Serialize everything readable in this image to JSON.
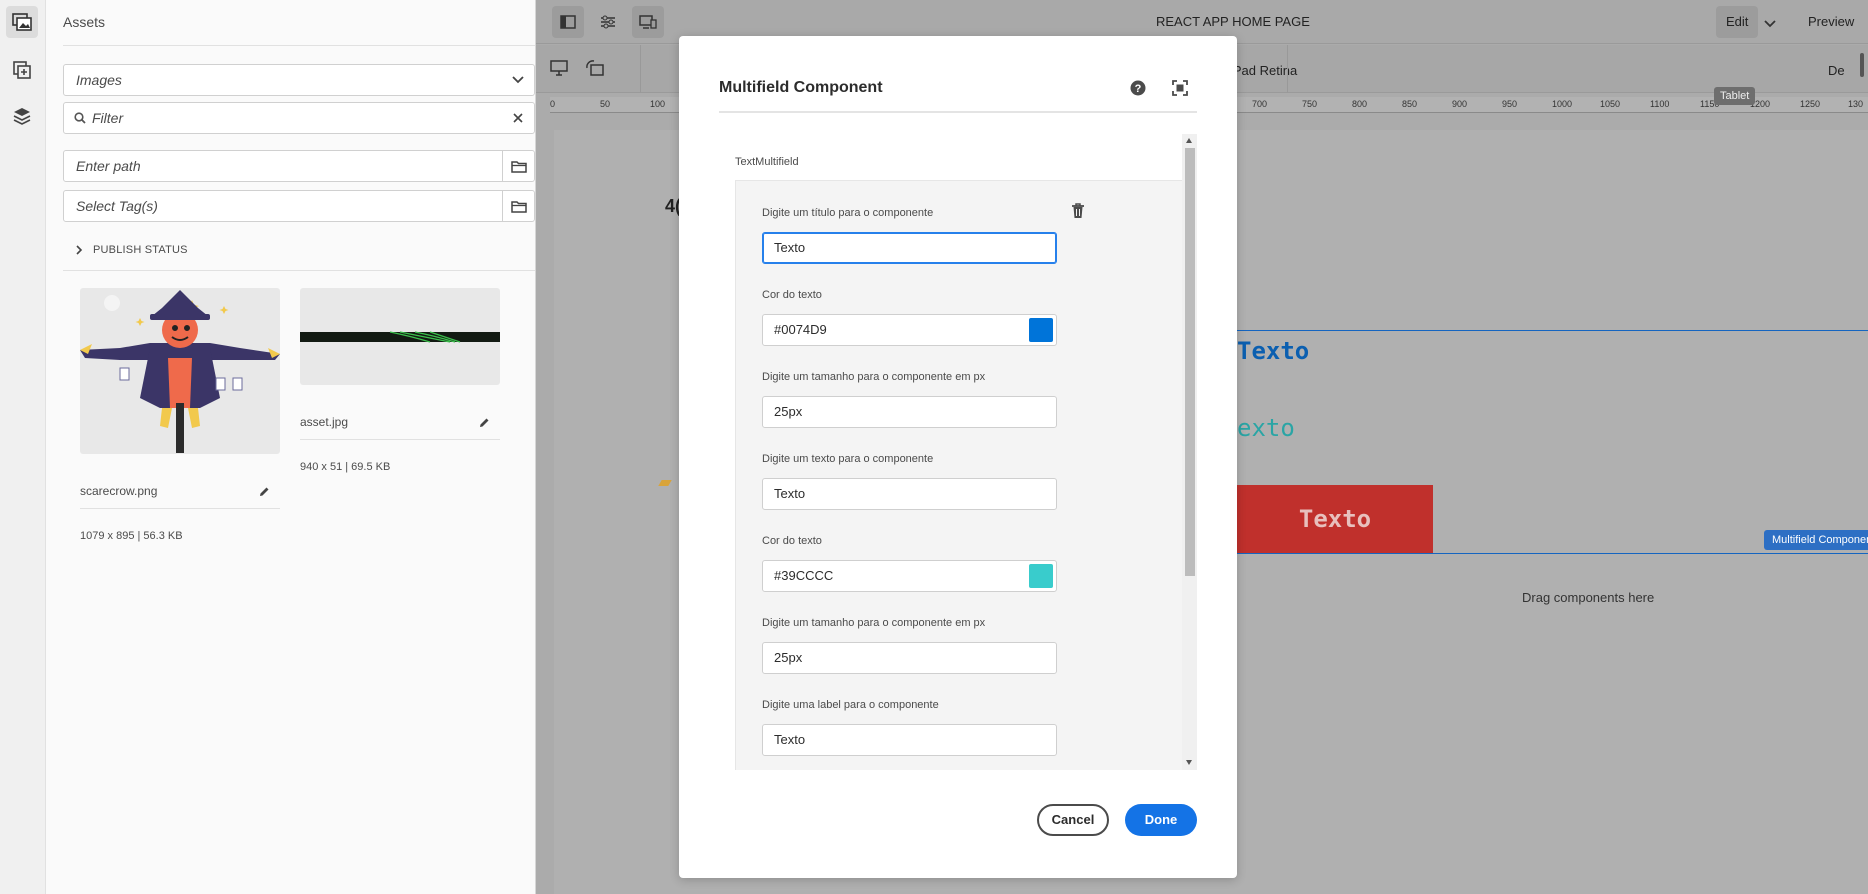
{
  "rail": {
    "icons": [
      "assets-icon",
      "components-icon",
      "layers-icon"
    ]
  },
  "assets_panel": {
    "title": "Assets",
    "type_select": "Images",
    "filter_placeholder": "Filter",
    "path_placeholder": "Enter path",
    "tags_placeholder": "Select Tag(s)",
    "publish_status": "PUBLISH STATUS",
    "cards": [
      {
        "name": "scarecrow.png",
        "meta": "1079 x 895 | 56.3 KB"
      },
      {
        "name": "asset.jpg",
        "meta": "940 x 51 | 69.5 KB"
      }
    ]
  },
  "editor": {
    "page_title": "REACT APP HOME PAGE",
    "mode": "Edit",
    "preview": "Preview",
    "device_label": "iPad Retina",
    "device_label_right": "De",
    "tooltip": "Tablet",
    "ruler": [
      "0",
      "50",
      "100",
      "700",
      "750",
      "800",
      "850",
      "900",
      "950",
      "1000",
      "1050",
      "1100",
      "1150",
      "1200",
      "1250",
      "130"
    ],
    "canvas_text_left": "4(",
    "canvas_text_1": "Texto",
    "canvas_text_2": "exto",
    "canvas_button": "Texto",
    "component_tag": "Multifield Component",
    "drag_here": "Drag components here"
  },
  "dialog": {
    "title": "Multifield Component",
    "section_label": "TextMultifield",
    "fields": [
      {
        "label": "Digite um título para o componente",
        "value": "Texto",
        "focused": true
      },
      {
        "label": "Cor do texto",
        "value": "#0074D9",
        "swatch": "#0074D9"
      },
      {
        "label": "Digite um tamanho para o componente em px",
        "value": "25px"
      },
      {
        "label": "Digite um texto para o componente",
        "value": "Texto"
      },
      {
        "label": "Cor do texto",
        "value": "#39CCCC",
        "swatch": "#39CCCC"
      },
      {
        "label": "Digite um tamanho para o componente em px",
        "value": "25px"
      },
      {
        "label": "Digite uma label para o componente",
        "value": "Texto"
      }
    ],
    "cancel": "Cancel",
    "done": "Done"
  },
  "colors": {
    "accent": "#1473E6",
    "red_button": "#C0302C",
    "blue_text": "#0074D9",
    "teal_text": "#39CCCC"
  }
}
